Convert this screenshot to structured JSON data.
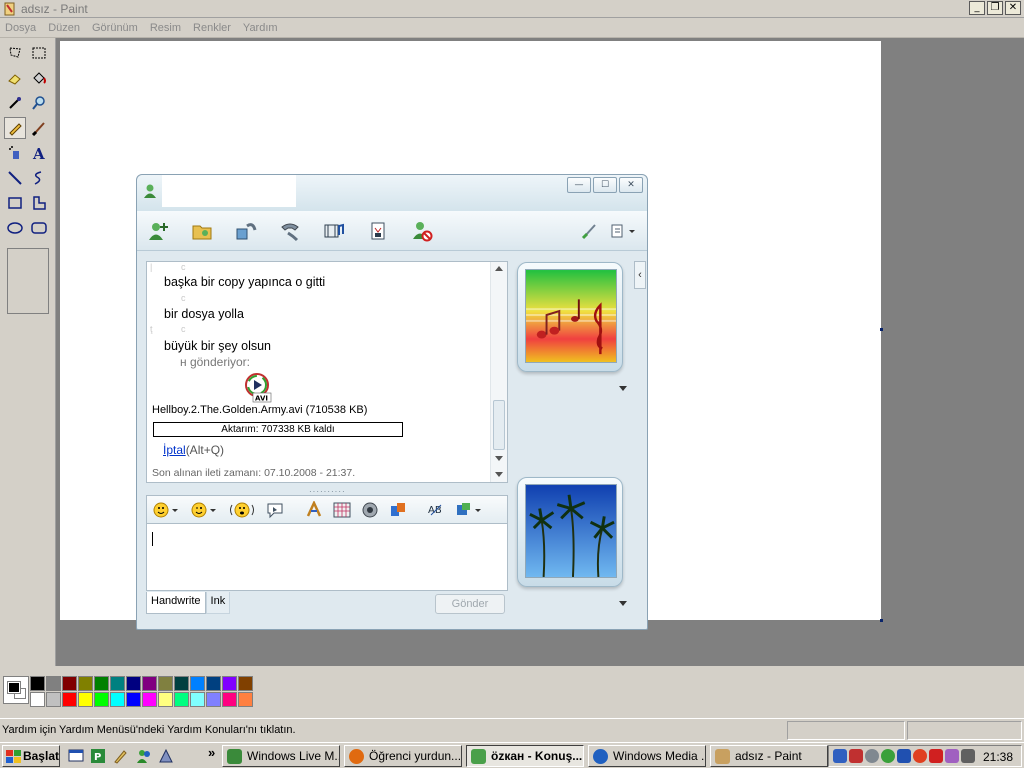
{
  "paint": {
    "title": "adsız - Paint",
    "menu": [
      "Dosya",
      "Düzen",
      "Görünüm",
      "Resim",
      "Renkler",
      "Yardım"
    ],
    "status_text": "Yardım için Yardım Menüsü'ndeki Yardım Konuları'nı tıklatın.",
    "palette_top": [
      "#000000",
      "#808080",
      "#800000",
      "#808000",
      "#008000",
      "#008080",
      "#000080",
      "#800080",
      "#808040",
      "#004040",
      "#0080ff",
      "#004080",
      "#8000ff",
      "#804000"
    ],
    "palette_bottom": [
      "#ffffff",
      "#c0c0c0",
      "#ff0000",
      "#ffff00",
      "#00ff00",
      "#00ffff",
      "#0000ff",
      "#ff00ff",
      "#ffff80",
      "#00ff80",
      "#80ffff",
      "#8080ff",
      "#ff0080",
      "#ff8040"
    ],
    "tools": [
      "free-select",
      "rect-select",
      "eraser",
      "fill",
      "color-picker",
      "magnifier",
      "pencil",
      "brush",
      "airbrush",
      "text",
      "line",
      "curve",
      "rectangle",
      "polygon",
      "ellipse",
      "rounded-rect"
    ],
    "selected_tool": "pencil"
  },
  "msn": {
    "messages": {
      "m1": "başka bir copy yapınca o gitti",
      "m2": "bir dosya yolla",
      "m3": "büyük bir şey olsun",
      "sending": "н gönderiyor:"
    },
    "file": {
      "badge": "AVI",
      "name": "Hellboy.2.The.Golden.Army.avi (710538 KB)",
      "progress_text": "Aktarım: 707338 KB kaldı",
      "progress_fraction": 0.0045,
      "cancel_link": "İptal",
      "cancel_shortcut": "(Alt+Q)"
    },
    "last_message": "Son alınan ileti zamanı: 07.10.2008 - 21:37.",
    "tabs": [
      "Handwrite",
      "Ink"
    ],
    "send_label": "Gönder",
    "toolbar_icons": [
      "invite-contact-icon",
      "share-folder-icon",
      "video-call-icon",
      "phone-call-icon",
      "video-icon",
      "games-icon",
      "block-contact-icon"
    ],
    "format_icons": [
      "emoticon-icon",
      "wink-icon",
      "nudge-icon",
      "voice-clip-icon",
      "font-icon",
      "background-icon",
      "webcam-icon",
      "winks-icon",
      "spell-check-icon",
      "more-icon"
    ]
  },
  "taskbar": {
    "start": "Başlat",
    "tasks": [
      {
        "label": "Windows Live M...",
        "icon": "#3a8a3a",
        "active": false
      },
      {
        "label": "Öğrenci yurdun...",
        "icon": "#e06a10",
        "active": false
      },
      {
        "label": "özкан - Konuş...",
        "icon": "#4aa04a",
        "active": true
      },
      {
        "label": "Windows Media ...",
        "icon": "#2060c0",
        "active": false
      },
      {
        "label": "adsız - Paint",
        "icon": "#c8a060",
        "active": false
      }
    ],
    "clock": "21:38",
    "more_glyph": "»"
  }
}
